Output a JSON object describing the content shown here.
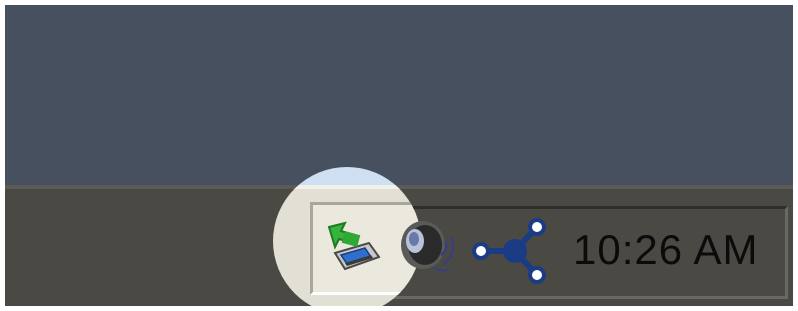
{
  "taskbar": {
    "clock": "10:26 AM"
  },
  "tray": {
    "icons": [
      {
        "name": "safely-remove-hardware-icon"
      },
      {
        "name": "volume-icon"
      },
      {
        "name": "network-icon"
      }
    ]
  },
  "colors": {
    "desktop": "#46505e",
    "taskbar": "#4b4944",
    "lens_taskbar": "#e2dfd4",
    "lens_desktop": "#cfe0f3",
    "network_blue": "#1b3b84",
    "arrow_green": "#35b33a"
  }
}
